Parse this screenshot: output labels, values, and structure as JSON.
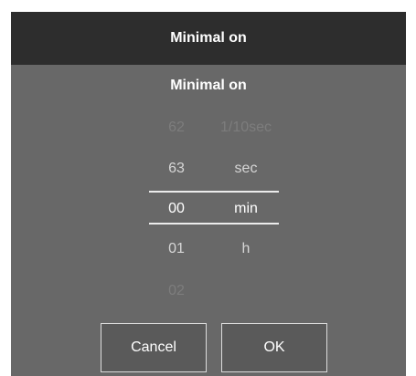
{
  "dialog": {
    "title": "Minimal on",
    "subtitle": "Minimal on"
  },
  "picker": {
    "value_column": [
      "62",
      "63",
      "00",
      "01",
      "02"
    ],
    "unit_column": [
      "1/10sec",
      "sec",
      "min",
      "h"
    ],
    "selected_value": "00",
    "selected_unit": "min"
  },
  "buttons": {
    "cancel_label": "Cancel",
    "ok_label": "OK"
  },
  "colors": {
    "dialog_background": "#686868",
    "titlebar_background": "#2d2d2d",
    "selection_line": "#ececec"
  }
}
